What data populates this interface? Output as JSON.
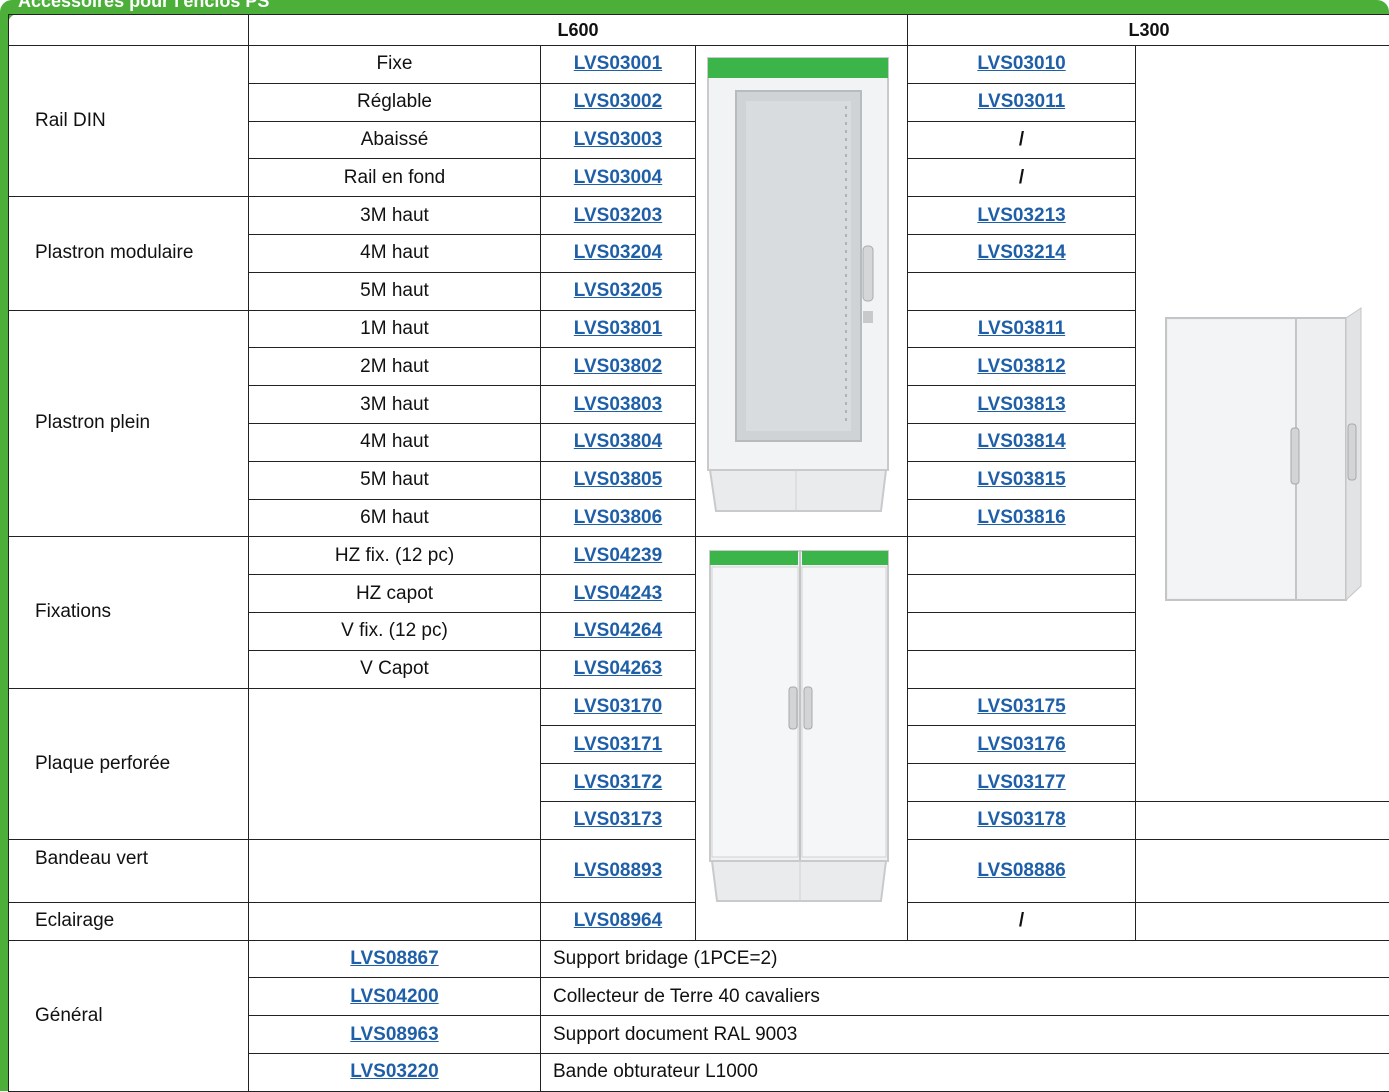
{
  "page": {
    "title": "Accessoires pour l'enclos PS"
  },
  "columns": {
    "l600": "L600",
    "l300": "L300"
  },
  "sections": {
    "rail_din": {
      "label": "Rail DIN",
      "rows": [
        {
          "item": "Fixe",
          "l600": "LVS03001",
          "l300": "LVS03010"
        },
        {
          "item": "Réglable",
          "l600": "LVS03002",
          "l300": "LVS03011"
        },
        {
          "item": "Abaissé",
          "l600": "LVS03003",
          "l300": "/"
        },
        {
          "item": "Rail en fond",
          "l600": "LVS03004",
          "l300": "/"
        }
      ]
    },
    "plastron_modulaire": {
      "label": "Plastron modulaire",
      "rows": [
        {
          "item": "3M haut",
          "l600": "LVS03203",
          "l300": "LVS03213"
        },
        {
          "item": "4M haut",
          "l600": "LVS03204",
          "l300": "LVS03214"
        },
        {
          "item": "5M haut",
          "l600": "LVS03205",
          "l300": ""
        }
      ]
    },
    "plastron_plein": {
      "label": "Plastron plein",
      "rows": [
        {
          "item": "1M haut",
          "l600": "LVS03801",
          "l300": "LVS03811"
        },
        {
          "item": "2M haut",
          "l600": "LVS03802",
          "l300": "LVS03812"
        },
        {
          "item": "3M haut",
          "l600": "LVS03803",
          "l300": "LVS03813"
        },
        {
          "item": "4M haut",
          "l600": "LVS03804",
          "l300": "LVS03814"
        },
        {
          "item": "5M haut",
          "l600": "LVS03805",
          "l300": "LVS03815"
        },
        {
          "item": "6M haut",
          "l600": "LVS03806",
          "l300": "LVS03816"
        }
      ]
    },
    "fixations": {
      "label": "Fixations",
      "rows": [
        {
          "item": "HZ fix. (12 pc)",
          "l600": "LVS04239",
          "l300": ""
        },
        {
          "item": "HZ capot",
          "l600": "LVS04243",
          "l300": ""
        },
        {
          "item": "V fix. (12 pc)",
          "l600": "LVS04264",
          "l300": ""
        },
        {
          "item": "V Capot",
          "l600": "LVS04263",
          "l300": ""
        }
      ]
    },
    "plaque_perforee": {
      "label": "Plaque perforée",
      "rows": [
        {
          "item": "",
          "l600": "LVS03170",
          "l300": "LVS03175"
        },
        {
          "item": "",
          "l600": "LVS03171",
          "l300": "LVS03176"
        },
        {
          "item": "",
          "l600": "LVS03172",
          "l300": "LVS03177"
        },
        {
          "item": "",
          "l600": "LVS03173",
          "l300": "LVS03178"
        }
      ]
    },
    "bandeau_vert": {
      "label": "Bandeau vert",
      "item": "",
      "l600": "LVS08893",
      "l300": "LVS08886"
    },
    "eclairage": {
      "label": "Eclairage",
      "item": "",
      "l600": "LVS08964",
      "l300": "/"
    },
    "general": {
      "label": "Général",
      "rows": [
        {
          "ref": "LVS08867",
          "desc": "Support bridage (1PCE=2)"
        },
        {
          "ref": "LVS04200",
          "desc": "Collecteur de Terre 40 cavaliers"
        },
        {
          "ref": "LVS08963",
          "desc": "Support document RAL 9003"
        },
        {
          "ref": "LVS03220",
          "desc": "Bande obturateur L1000"
        }
      ]
    }
  },
  "images": {
    "cabinet_glass_door": "enclosure-glass-door-icon",
    "cabinet_double_door": "enclosure-double-door-icon",
    "cabinet_l300": "enclosure-l300-icon"
  },
  "colors": {
    "accent_green": "#4caf3a",
    "link_blue": "#1f5fa8",
    "brand_stripe": "#3bb54a"
  }
}
